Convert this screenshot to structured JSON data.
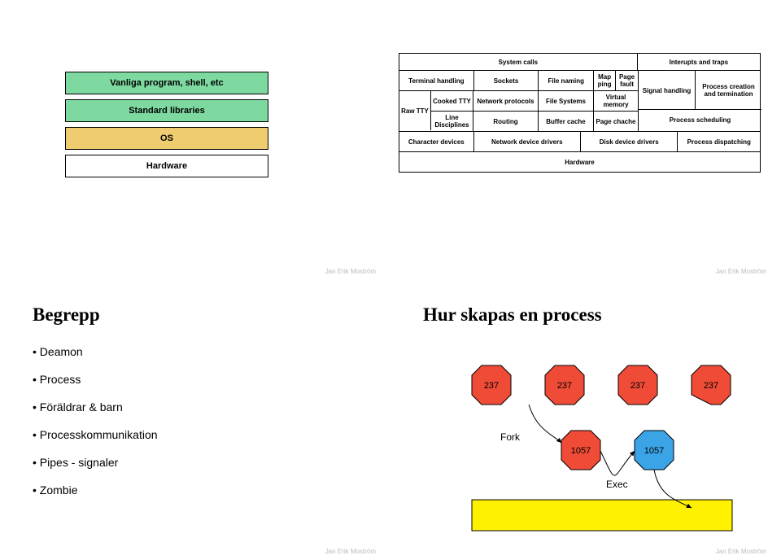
{
  "q1": {
    "layers": [
      "Vanliga program, shell, etc",
      "Standard libraries",
      "OS",
      "Hardware"
    ]
  },
  "q2": {
    "row0": {
      "syscalls": "System calls",
      "interrupts": "Interupts and traps"
    },
    "row1": {
      "th": "Terminal handling",
      "sock": "Sockets",
      "fn": "File naming",
      "mp": "Map ping",
      "pf": "Page fault",
      "sig": "Signal handling",
      "pct": "Process creation and termination"
    },
    "row2": {
      "raw": "Raw TTY",
      "ctty": "Cooked TTY",
      "np": "Network protocols",
      "fs": "File Systems",
      "vm": "Virtual memory"
    },
    "row3": {
      "ld": "Line Disciplines",
      "rout": "Routing",
      "bc": "Buffer cache",
      "pc": "Page chache",
      "ps": "Process scheduling"
    },
    "row4": {
      "cd": "Character devices",
      "ndd": "Network device drivers",
      "ddd": "Disk device drivers",
      "pd": "Process dispatching"
    },
    "row5": {
      "hw": "Hardware"
    }
  },
  "q3": {
    "title": "Begrepp",
    "items": [
      "Deamon",
      "Process",
      "Föräldrar & barn",
      "Processkommunikation",
      "Pipes - signaler",
      "Zombie"
    ]
  },
  "q4": {
    "title": "Hur skapas en process",
    "pid_parent": "237",
    "pid_child": "1057",
    "fork_label": "Fork",
    "exec_label": "Exec"
  },
  "attribution": "Jan Erik Moström"
}
